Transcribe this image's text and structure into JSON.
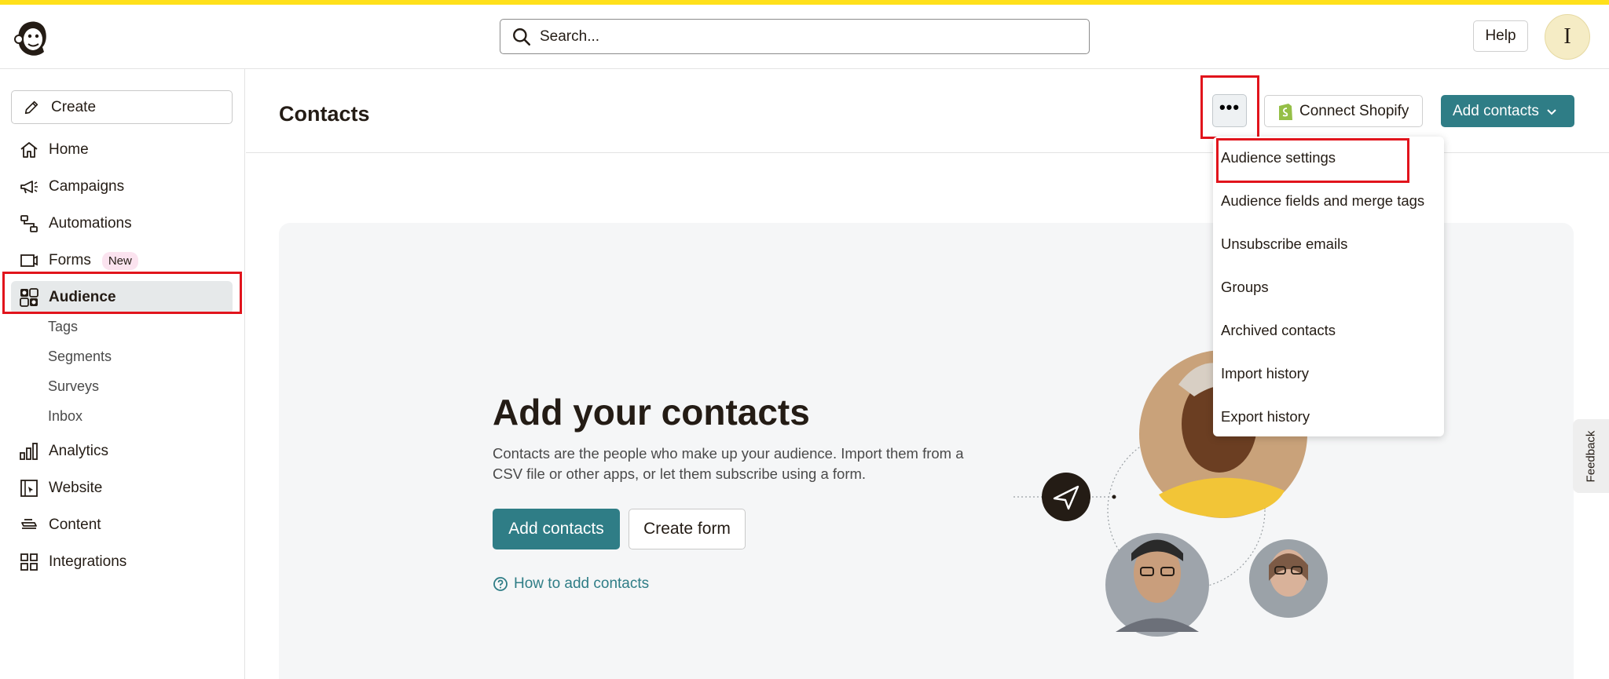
{
  "header": {
    "search_placeholder": "Search...",
    "help_label": "Help",
    "avatar_initial": "I"
  },
  "sidebar": {
    "create_label": "Create",
    "items": [
      {
        "label": "Home",
        "icon": "home-icon"
      },
      {
        "label": "Campaigns",
        "icon": "megaphone-icon"
      },
      {
        "label": "Automations",
        "icon": "automations-icon"
      },
      {
        "label": "Forms",
        "icon": "forms-icon",
        "badge": "New"
      },
      {
        "label": "Audience",
        "icon": "audience-icon",
        "active": true
      },
      {
        "label": "Analytics",
        "icon": "analytics-icon"
      },
      {
        "label": "Website",
        "icon": "website-icon"
      },
      {
        "label": "Content",
        "icon": "content-icon"
      },
      {
        "label": "Integrations",
        "icon": "integrations-icon"
      }
    ],
    "audience_subitems": [
      "Tags",
      "Segments",
      "Surveys",
      "Inbox"
    ]
  },
  "main": {
    "title": "Contacts",
    "connect_shopify_label": "Connect Shopify",
    "add_contacts_label": "Add contacts",
    "more_label": "•••",
    "empty_state": {
      "title": "Add your contacts",
      "description": "Contacts are the people who make up your audience. Import them from a CSV file or other apps, or let them subscribe using a form.",
      "primary_button": "Add contacts",
      "secondary_button": "Create form",
      "help_link": "How to add contacts"
    }
  },
  "dropdown": {
    "items": [
      "Audience settings",
      "Audience fields and merge tags",
      "Unsubscribe emails",
      "Groups",
      "Archived contacts",
      "Import history",
      "Export history"
    ]
  },
  "feedback_label": "Feedback",
  "colors": {
    "accent": "#2f7d86",
    "brand_yellow": "#ffe01b",
    "highlight": "#e1141c"
  }
}
